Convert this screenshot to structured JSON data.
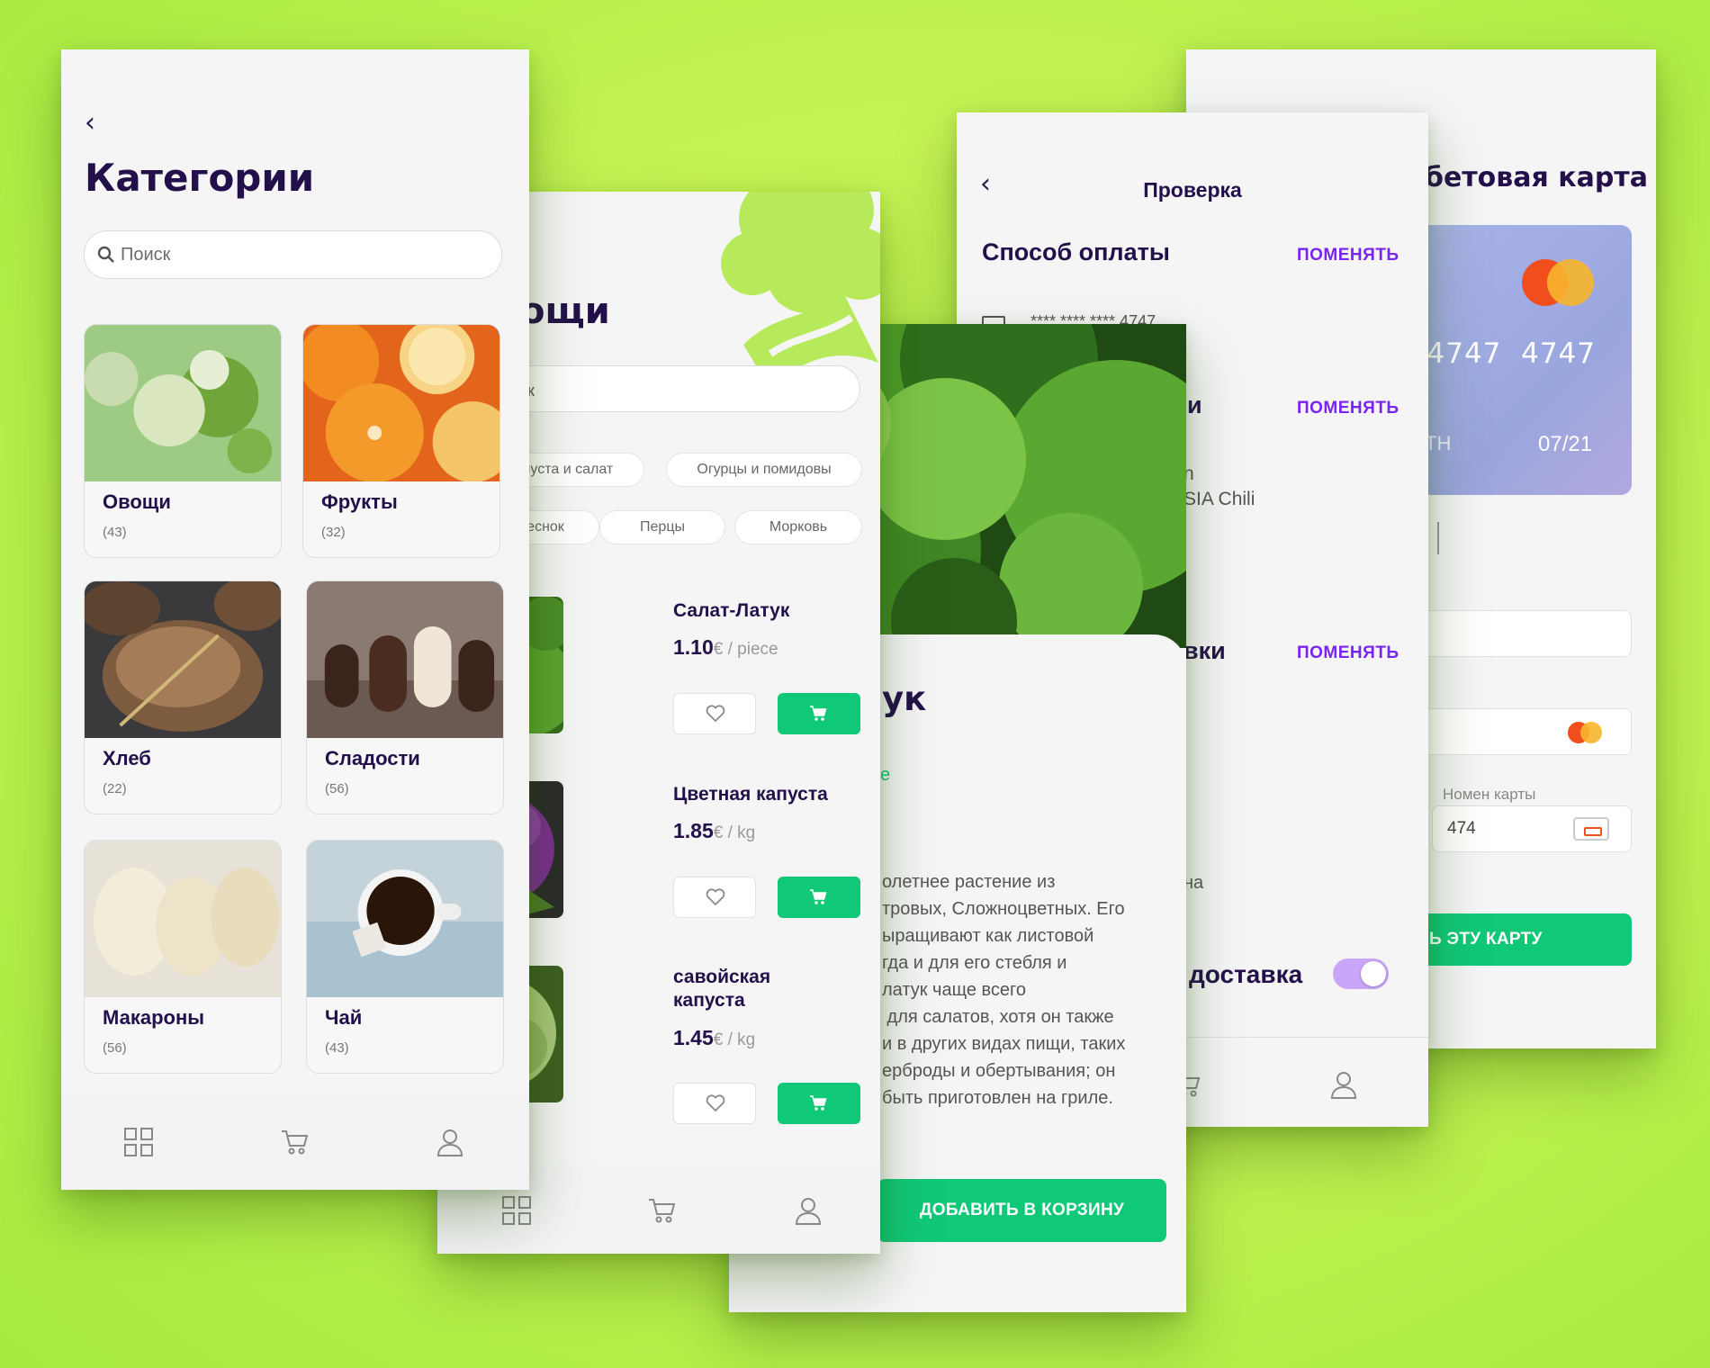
{
  "categories_screen": {
    "title": "Категории",
    "search_placeholder": "Поиск",
    "items": [
      {
        "name": "Овощи",
        "count": "(43)"
      },
      {
        "name": "Фрукты",
        "count": "(32)"
      },
      {
        "name": "Хлеб",
        "count": "(22)"
      },
      {
        "name": "Сладости",
        "count": "(56)"
      },
      {
        "name": "Макароны",
        "count": "(56)"
      },
      {
        "name": "Чай",
        "count": "(43)"
      }
    ]
  },
  "vegetables_screen": {
    "title_partial": "ощи",
    "search_partial": "ск",
    "filters": [
      "пуста и салат",
      "Огурцы и помидовы",
      "еснок",
      "Перцы",
      "Морковь"
    ],
    "products": [
      {
        "name": "Салат-Латук",
        "price": "1.10",
        "unit": "€ / piece"
      },
      {
        "name": "Цветная капуста",
        "price": "1.85",
        "unit": "€ / kg"
      },
      {
        "name": "савойская капуста",
        "price": "1.45",
        "unit": "€ / kg"
      }
    ]
  },
  "product_screen": {
    "title_partial": "ук",
    "link_partial": "е",
    "description_lines": [
      "олетнее растение из",
      "тровых, Сложноцветных. Его",
      "ыращивают как листовой",
      "гда и для его стебля и",
      "латук чаще всего",
      " для салатов, хотя он также",
      "и в других видах пищи, таких",
      "ерброды и обертывания; он",
      "быть приготовлен на гриле."
    ],
    "add_to_cart": "ДОБАВИТЬ В КОРЗИНУ"
  },
  "checkout_screen": {
    "title": "Проверка",
    "payment_title": "Способ оплаты",
    "change": "ПОМЕНЯТЬ",
    "card_masked": "**** **** **** 4747",
    "section2_partial": "и",
    "address_partial_1": "n",
    "address_partial_2": "SIA Chili",
    "section3_partial": "вки",
    "delivery_partial": "на",
    "delivery_label": "доставка",
    "toggle_on": true
  },
  "card_screen": {
    "title_partial": "бетовая карта",
    "card_numbers_partial": "4747  4747",
    "holder_partial": "ТН",
    "expiry": "07/21",
    "card_number_label": "Номен карты",
    "card_number_value": "474",
    "save_button_partial": "Ь ЭТУ КАРТУ"
  },
  "colors": {
    "primary_green": "#10c978",
    "accent_violet": "#7a24f0",
    "dark_text": "#23104a",
    "background_lime": "#c4f354"
  }
}
